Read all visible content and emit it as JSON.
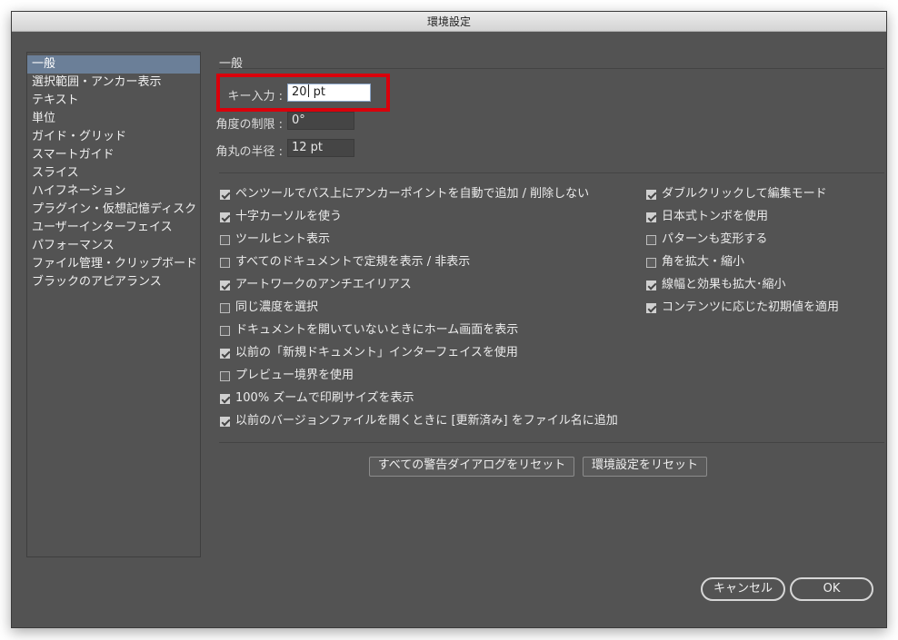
{
  "window": {
    "title": "環境設定"
  },
  "sidebar": {
    "items": [
      {
        "label": "一般",
        "selected": true
      },
      {
        "label": "選択範囲・アンカー表示",
        "selected": false
      },
      {
        "label": "テキスト",
        "selected": false
      },
      {
        "label": "単位",
        "selected": false
      },
      {
        "label": "ガイド・グリッド",
        "selected": false
      },
      {
        "label": "スマートガイド",
        "selected": false
      },
      {
        "label": "スライス",
        "selected": false
      },
      {
        "label": "ハイフネーション",
        "selected": false
      },
      {
        "label": "プラグイン・仮想記憶ディスク",
        "selected": false
      },
      {
        "label": "ユーザーインターフェイス",
        "selected": false
      },
      {
        "label": "パフォーマンス",
        "selected": false
      },
      {
        "label": "ファイル管理・クリップボード",
        "selected": false
      },
      {
        "label": "ブラックのアピアランス",
        "selected": false
      }
    ]
  },
  "main": {
    "section_title": "一般",
    "fields": {
      "keyboard_increment": {
        "label": "キー入力 :",
        "value_before_caret": "20",
        "value_after_caret": " pt"
      },
      "constrain_angle": {
        "label": "角度の制限 :",
        "value": "0°"
      },
      "corner_radius": {
        "label": "角丸の半径 :",
        "value": "12 pt"
      }
    },
    "left_options": [
      {
        "label": "ペンツールでパス上にアンカーポイントを自動で追加 / 削除しない",
        "checked": true
      },
      {
        "label": "十字カーソルを使う",
        "checked": true
      },
      {
        "label": "ツールヒント表示",
        "checked": false
      },
      {
        "label": "すべてのドキュメントで定規を表示 / 非表示",
        "checked": false
      },
      {
        "label": "アートワークのアンチエイリアス",
        "checked": true
      },
      {
        "label": "同じ濃度を選択",
        "checked": false
      },
      {
        "label": "ドキュメントを開いていないときにホーム画面を表示",
        "checked": false
      },
      {
        "label": "以前の「新規ドキュメント」インターフェイスを使用",
        "checked": true
      },
      {
        "label": "プレビュー境界を使用",
        "checked": false
      },
      {
        "label": "100% ズームで印刷サイズを表示",
        "checked": true
      },
      {
        "label": "以前のバージョンファイルを開くときに [更新済み] をファイル名に追加",
        "checked": true
      }
    ],
    "right_options": [
      {
        "label": "ダブルクリックして編集モード",
        "checked": true
      },
      {
        "label": "日本式トンボを使用",
        "checked": true
      },
      {
        "label": "パターンも変形する",
        "checked": false
      },
      {
        "label": "角を拡大・縮小",
        "checked": false
      },
      {
        "label": "線幅と効果も拡大･縮小",
        "checked": true
      },
      {
        "label": "コンテンツに応じた初期値を適用",
        "checked": true
      }
    ],
    "reset_warnings_label": "すべての警告ダイアログをリセット",
    "reset_prefs_label": "環境設定をリセット"
  },
  "footer": {
    "cancel_label": "キャンセル",
    "ok_label": "OK"
  },
  "colors": {
    "panel_bg": "#535353",
    "selection": "#6b7f98",
    "highlight": "#d9000b"
  }
}
